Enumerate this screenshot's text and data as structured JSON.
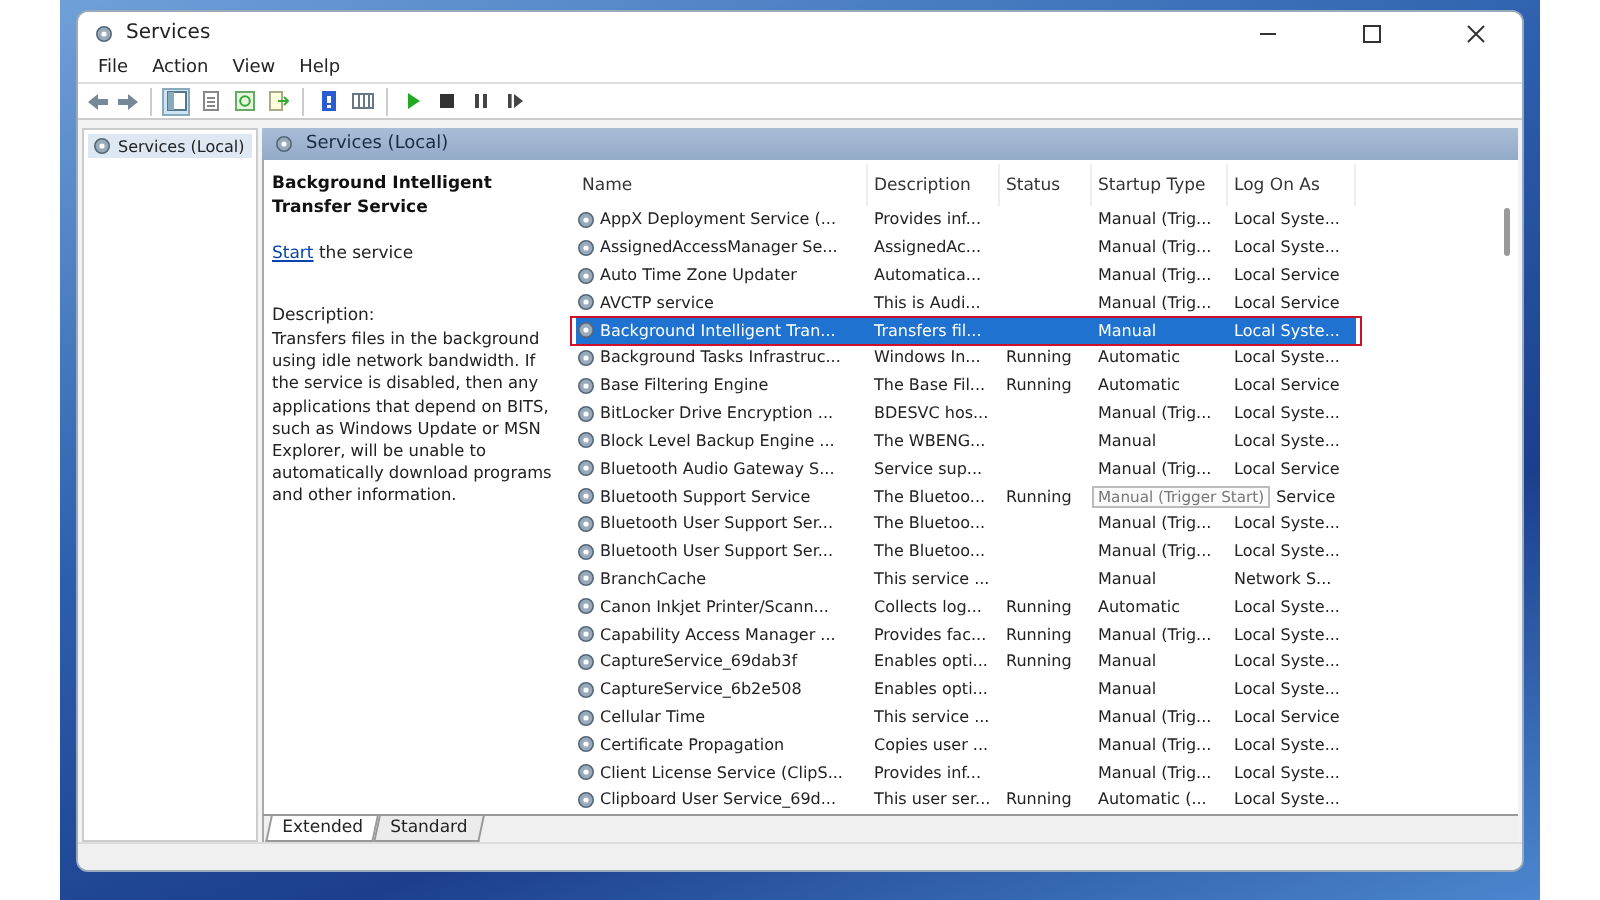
{
  "window": {
    "title": "Services"
  },
  "menu": [
    "File",
    "Action",
    "View",
    "Help"
  ],
  "tree": [
    {
      "label": "Services (Local)",
      "selected": true
    }
  ],
  "pane_title": "Services (Local)",
  "detail": {
    "service_name": "Background Intelligent Transfer Service",
    "action_link": "Start",
    "action_text": " the service",
    "description_label": "Description:",
    "description": "Transfers files in the background using idle network bandwidth. If the service is disabled, then any applications that depend on BITS, such as Windows Update or MSN Explorer, will be unable to automatically download programs and other information."
  },
  "columns": [
    "Name",
    "Description",
    "Status",
    "Startup Type",
    "Log On As"
  ],
  "rows": [
    {
      "name": "AppX Deployment Service (...",
      "description": "Provides inf...",
      "status": "",
      "startup_type": "Manual (Trig...",
      "log_on": "Local Syste...",
      "selected": false
    },
    {
      "name": "AssignedAccessManager Se...",
      "description": "AssignedAc...",
      "status": "",
      "startup_type": "Manual (Trig...",
      "log_on": "Local Syste...",
      "selected": false
    },
    {
      "name": "Auto Time Zone Updater",
      "description": "Automatica...",
      "status": "",
      "startup_type": "Manual (Trig...",
      "log_on": "Local Service",
      "selected": false
    },
    {
      "name": "AVCTP service",
      "description": "This is Audi...",
      "status": "",
      "startup_type": "Manual (Trig...",
      "log_on": "Local Service",
      "selected": false
    },
    {
      "name": "Background Intelligent Tran...",
      "description": "Transfers fil...",
      "status": "",
      "startup_type": "Manual",
      "log_on": "Local Syste...",
      "selected": true,
      "framed": true
    },
    {
      "name": "Background Tasks Infrastruc...",
      "description": "Windows In...",
      "status": "Running",
      "startup_type": "Automatic",
      "log_on": "Local Syste...",
      "selected": false
    },
    {
      "name": "Base Filtering Engine",
      "description": "The Base Fil...",
      "status": "Running",
      "startup_type": "Automatic",
      "log_on": "Local Service",
      "selected": false
    },
    {
      "name": "BitLocker Drive Encryption ...",
      "description": "BDESVC hos...",
      "status": "",
      "startup_type": "Manual (Trig...",
      "log_on": "Local Syste...",
      "selected": false
    },
    {
      "name": "Block Level Backup Engine ...",
      "description": "The WBENG...",
      "status": "",
      "startup_type": "Manual",
      "log_on": "Local Syste...",
      "selected": false
    },
    {
      "name": "Bluetooth Audio Gateway S...",
      "description": "Service sup...",
      "status": "",
      "startup_type": "Manual (Trig...",
      "log_on": "Local Service",
      "selected": false
    },
    {
      "name": "Bluetooth Support Service",
      "description": "The Bluetoo...",
      "status": "Running",
      "tooltip": "Manual (Trigger Start)",
      "log_on": "Service",
      "selected": false
    },
    {
      "name": "Bluetooth User Support Ser...",
      "description": "The Bluetoo...",
      "status": "",
      "startup_type": "Manual (Trig...",
      "log_on": "Local Syste...",
      "selected": false
    },
    {
      "name": "Bluetooth User Support Ser...",
      "description": "The Bluetoo...",
      "status": "",
      "startup_type": "Manual (Trig...",
      "log_on": "Local Syste...",
      "selected": false
    },
    {
      "name": "BranchCache",
      "description": "This service ...",
      "status": "",
      "startup_type": "Manual",
      "log_on": "Network S...",
      "selected": false
    },
    {
      "name": "Canon Inkjet Printer/Scann...",
      "description": "Collects log...",
      "status": "Running",
      "startup_type": "Automatic",
      "log_on": "Local Syste...",
      "selected": false
    },
    {
      "name": "Capability Access Manager ...",
      "description": "Provides fac...",
      "status": "Running",
      "startup_type": "Manual (Trig...",
      "log_on": "Local Syste...",
      "selected": false
    },
    {
      "name": "CaptureService_69dab3f",
      "description": "Enables opti...",
      "status": "Running",
      "startup_type": "Manual",
      "log_on": "Local Syste...",
      "selected": false
    },
    {
      "name": "CaptureService_6b2e508",
      "description": "Enables opti...",
      "status": "",
      "startup_type": "Manual",
      "log_on": "Local Syste...",
      "selected": false
    },
    {
      "name": "Cellular Time",
      "description": "This service ...",
      "status": "",
      "startup_type": "Manual (Trig...",
      "log_on": "Local Service",
      "selected": false
    },
    {
      "name": "Certificate Propagation",
      "description": "Copies user ...",
      "status": "",
      "startup_type": "Manual (Trig...",
      "log_on": "Local Syste...",
      "selected": false
    },
    {
      "name": "Client License Service (ClipS...",
      "description": "Provides inf...",
      "status": "",
      "startup_type": "Manual (Trig...",
      "log_on": "Local Syste...",
      "selected": false
    },
    {
      "name": "Clipboard User Service_69d...",
      "description": "This user ser...",
      "status": "Running",
      "startup_type": "Automatic (...",
      "log_on": "Local Syste...",
      "selected": false
    }
  ],
  "tabs": [
    {
      "label": "Extended",
      "selected": true
    },
    {
      "label": "Standard",
      "selected": false
    }
  ]
}
